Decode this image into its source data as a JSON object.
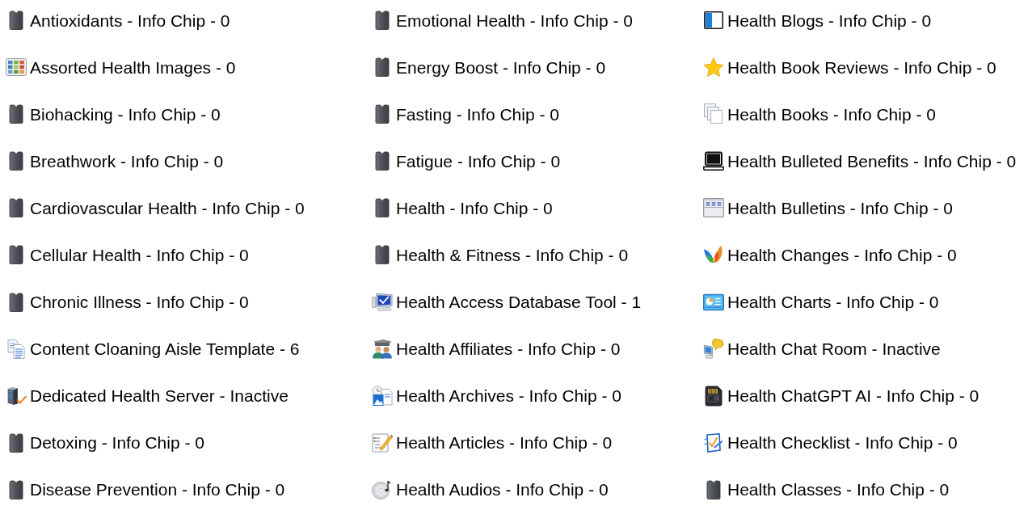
{
  "columns": [
    {
      "items": [
        {
          "label": "Antioxidants - Info Chip - 0",
          "kind": "chip"
        },
        {
          "label": "Assorted Health Images - 0",
          "kind": "gallery"
        },
        {
          "label": "Biohacking - Info Chip - 0",
          "kind": "chip"
        },
        {
          "label": "Breathwork - Info Chip - 0",
          "kind": "chip"
        },
        {
          "label": "Cardiovascular Health - Info Chip - 0",
          "kind": "chip"
        },
        {
          "label": "Cellular Health - Info Chip - 0",
          "kind": "chip"
        },
        {
          "label": "Chronic Illness - Info Chip - 0",
          "kind": "chip"
        },
        {
          "label": "Content Cloaning Aisle Template - 6",
          "kind": "documents"
        },
        {
          "label": "Dedicated Health Server - Inactive",
          "kind": "server"
        },
        {
          "label": "Detoxing - Info Chip - 0",
          "kind": "chip"
        },
        {
          "label": "Disease Prevention - Info Chip - 0",
          "kind": "chip"
        }
      ]
    },
    {
      "items": [
        {
          "label": "Emotional Health - Info Chip - 0",
          "kind": "chip"
        },
        {
          "label": "Energy Boost - Info Chip - 0",
          "kind": "chip"
        },
        {
          "label": "Fasting - Info Chip - 0",
          "kind": "chip"
        },
        {
          "label": "Fatigue - Info Chip - 0",
          "kind": "chip"
        },
        {
          "label": "Health - Info Chip - 0",
          "kind": "chip"
        },
        {
          "label": "Health & Fitness - Info Chip - 0",
          "kind": "chip"
        },
        {
          "label": "Health Access Database Tool - 1",
          "kind": "computer"
        },
        {
          "label": "Health Affiliates - Info Chip - 0",
          "kind": "people"
        },
        {
          "label": "Health Archives - Info Chip - 0",
          "kind": "picture"
        },
        {
          "label": "Health Articles - Info Chip - 0",
          "kind": "notepad"
        },
        {
          "label": "Health Audios - Info Chip - 0",
          "kind": "disc"
        }
      ]
    },
    {
      "items": [
        {
          "label": "Health Blogs - Info Chip - 0",
          "kind": "panel"
        },
        {
          "label": "Health Book Reviews - Info Chip - 0",
          "kind": "star"
        },
        {
          "label": "Health Books - Info Chip - 0",
          "kind": "pages"
        },
        {
          "label": "Health Bulleted Benefits - Info Chip - 0",
          "kind": "laptop"
        },
        {
          "label": "Health Bulletins - Info Chip - 0",
          "kind": "table"
        },
        {
          "label": "Health Changes - Info Chip - 0",
          "kind": "butterfly"
        },
        {
          "label": "Health Charts - Info Chip - 0",
          "kind": "chart"
        },
        {
          "label": "Health Chat Room - Inactive",
          "kind": "chat"
        },
        {
          "label": "Health ChatGPT AI - Info Chip - 0",
          "kind": "card"
        },
        {
          "label": "Health Checklist - Info Chip - 0",
          "kind": "checklist"
        },
        {
          "label": "Health Classes - Info Chip - 0",
          "kind": "chip"
        }
      ]
    }
  ]
}
